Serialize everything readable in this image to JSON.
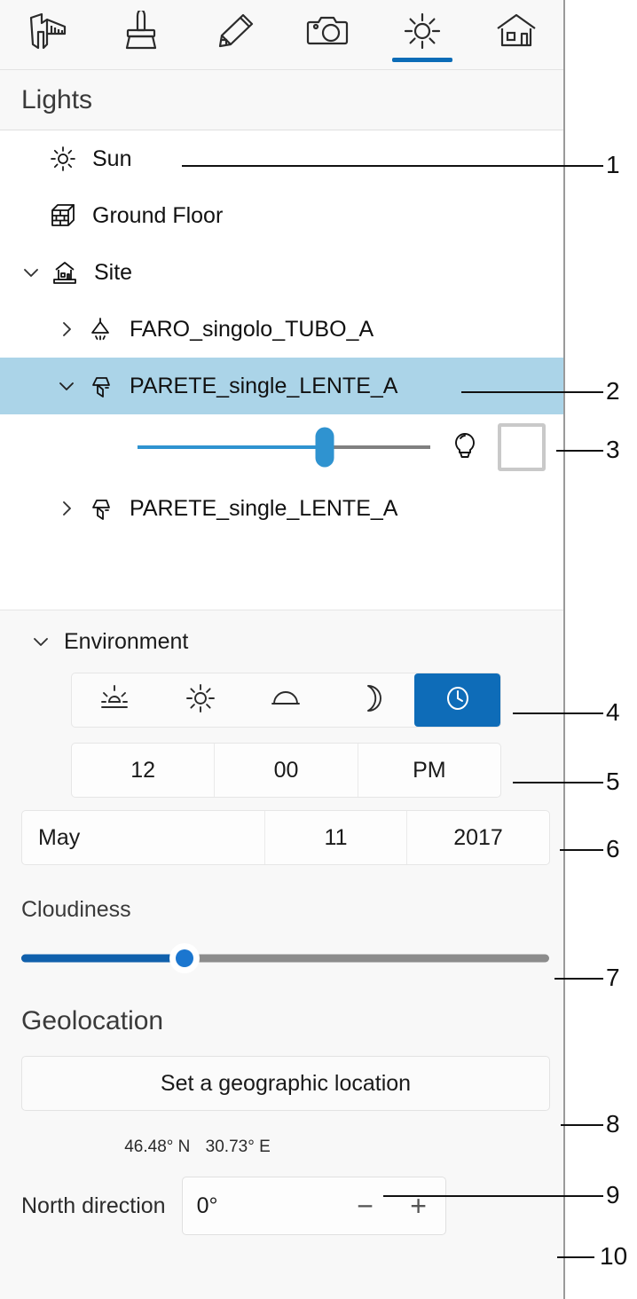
{
  "toolbar": {
    "tools": [
      {
        "name": "measure-tool",
        "icon": "ruler-icon",
        "active": false
      },
      {
        "name": "paint-tool",
        "icon": "brush-icon",
        "active": false
      },
      {
        "name": "draw-tool",
        "icon": "pencil-icon",
        "active": false
      },
      {
        "name": "camera-tool",
        "icon": "camera-icon",
        "active": false
      },
      {
        "name": "lighting-tool",
        "icon": "sun-icon",
        "active": true
      },
      {
        "name": "building-tool",
        "icon": "house-icon",
        "active": false
      }
    ]
  },
  "lights_panel": {
    "title": "Lights",
    "tree": [
      {
        "label": "Sun",
        "icon": "sun-small-icon",
        "chevron": "none",
        "indent": 0,
        "selected": false
      },
      {
        "label": "Ground Floor",
        "icon": "brick-block-icon",
        "chevron": "none",
        "indent": 0,
        "selected": false
      },
      {
        "label": "Site",
        "icon": "site-house-icon",
        "chevron": "expanded",
        "indent": 1,
        "selected": false
      },
      {
        "label": "FARO_singolo_TUBO_A",
        "icon": "ceiling-lamp-icon",
        "chevron": "collapsed",
        "indent": 2,
        "selected": false
      },
      {
        "label": "PARETE_single_LENTE_A",
        "icon": "wall-lamp-icon",
        "chevron": "expanded",
        "indent": 2,
        "selected": true
      },
      {
        "label": "PARETE_single_LENTE_A",
        "icon": "wall-lamp-icon",
        "chevron": "collapsed",
        "indent": 2,
        "selected": false
      }
    ],
    "light_controls": {
      "intensity_percent": 64,
      "bulb_icon": "light-bulb-icon",
      "color_swatch": "#ffffff"
    }
  },
  "environment": {
    "header": "Environment",
    "presets": [
      {
        "name": "sunrise-preset",
        "icon": "sunrise-icon",
        "active": false
      },
      {
        "name": "midday-preset",
        "icon": "sun-icon",
        "active": false
      },
      {
        "name": "overcast-preset",
        "icon": "cloud-icon",
        "active": false
      },
      {
        "name": "night-preset",
        "icon": "moon-icon",
        "active": false
      },
      {
        "name": "custom-time-preset",
        "icon": "clock-icon",
        "active": true
      }
    ],
    "time": {
      "hour": "12",
      "minute": "00",
      "meridiem": "PM"
    },
    "date": {
      "month": "May",
      "day": "11",
      "year": "2017"
    },
    "cloudiness": {
      "label": "Cloudiness",
      "value_percent": 31
    }
  },
  "geolocation": {
    "title": "Geolocation",
    "set_location_label": "Set a geographic location",
    "latitude": "46.48° N",
    "longitude": "30.73° E",
    "north_direction": {
      "label": "North direction",
      "value": "0°",
      "decrement_label": "−",
      "increment_label": "+"
    }
  },
  "callouts": [
    {
      "number": "1"
    },
    {
      "number": "2"
    },
    {
      "number": "3"
    },
    {
      "number": "4"
    },
    {
      "number": "5"
    },
    {
      "number": "6"
    },
    {
      "number": "7"
    },
    {
      "number": "8"
    },
    {
      "number": "9"
    },
    {
      "number": "10"
    }
  ],
  "colors": {
    "accent_blue": "#0e6cb8",
    "selection_blue": "#abd4e8",
    "slider_blue": "#2f93d0",
    "track_gray": "#8c8c8c"
  }
}
